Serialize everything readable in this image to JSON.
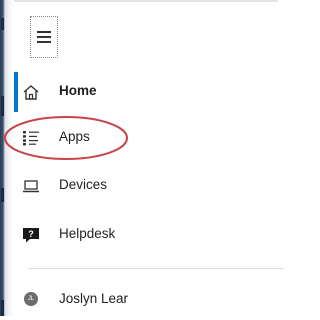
{
  "nav": {
    "menu_button": "hamburger-icon",
    "items": [
      {
        "label": "Home",
        "icon": "home-icon",
        "active": true
      },
      {
        "label": "Apps",
        "icon": "apps-list-icon",
        "highlighted": true
      },
      {
        "label": "Devices",
        "icon": "laptop-icon"
      },
      {
        "label": "Helpdesk",
        "icon": "help-icon"
      }
    ],
    "user": {
      "initials": "JL",
      "name": "Joslyn Lear"
    }
  },
  "colors": {
    "accent": "#0078d4",
    "highlight": "#c9434a"
  }
}
